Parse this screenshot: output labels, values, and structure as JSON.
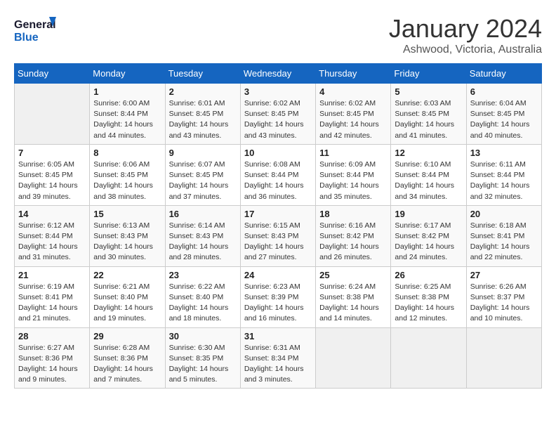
{
  "logo": {
    "line1": "General",
    "line2": "Blue"
  },
  "title": "January 2024",
  "subtitle": "Ashwood, Victoria, Australia",
  "weekdays": [
    "Sunday",
    "Monday",
    "Tuesday",
    "Wednesday",
    "Thursday",
    "Friday",
    "Saturday"
  ],
  "weeks": [
    [
      {
        "num": "",
        "info": ""
      },
      {
        "num": "1",
        "info": "Sunrise: 6:00 AM\nSunset: 8:44 PM\nDaylight: 14 hours\nand 44 minutes."
      },
      {
        "num": "2",
        "info": "Sunrise: 6:01 AM\nSunset: 8:45 PM\nDaylight: 14 hours\nand 43 minutes."
      },
      {
        "num": "3",
        "info": "Sunrise: 6:02 AM\nSunset: 8:45 PM\nDaylight: 14 hours\nand 43 minutes."
      },
      {
        "num": "4",
        "info": "Sunrise: 6:02 AM\nSunset: 8:45 PM\nDaylight: 14 hours\nand 42 minutes."
      },
      {
        "num": "5",
        "info": "Sunrise: 6:03 AM\nSunset: 8:45 PM\nDaylight: 14 hours\nand 41 minutes."
      },
      {
        "num": "6",
        "info": "Sunrise: 6:04 AM\nSunset: 8:45 PM\nDaylight: 14 hours\nand 40 minutes."
      }
    ],
    [
      {
        "num": "7",
        "info": "Sunrise: 6:05 AM\nSunset: 8:45 PM\nDaylight: 14 hours\nand 39 minutes."
      },
      {
        "num": "8",
        "info": "Sunrise: 6:06 AM\nSunset: 8:45 PM\nDaylight: 14 hours\nand 38 minutes."
      },
      {
        "num": "9",
        "info": "Sunrise: 6:07 AM\nSunset: 8:45 PM\nDaylight: 14 hours\nand 37 minutes."
      },
      {
        "num": "10",
        "info": "Sunrise: 6:08 AM\nSunset: 8:44 PM\nDaylight: 14 hours\nand 36 minutes."
      },
      {
        "num": "11",
        "info": "Sunrise: 6:09 AM\nSunset: 8:44 PM\nDaylight: 14 hours\nand 35 minutes."
      },
      {
        "num": "12",
        "info": "Sunrise: 6:10 AM\nSunset: 8:44 PM\nDaylight: 14 hours\nand 34 minutes."
      },
      {
        "num": "13",
        "info": "Sunrise: 6:11 AM\nSunset: 8:44 PM\nDaylight: 14 hours\nand 32 minutes."
      }
    ],
    [
      {
        "num": "14",
        "info": "Sunrise: 6:12 AM\nSunset: 8:44 PM\nDaylight: 14 hours\nand 31 minutes."
      },
      {
        "num": "15",
        "info": "Sunrise: 6:13 AM\nSunset: 8:43 PM\nDaylight: 14 hours\nand 30 minutes."
      },
      {
        "num": "16",
        "info": "Sunrise: 6:14 AM\nSunset: 8:43 PM\nDaylight: 14 hours\nand 28 minutes."
      },
      {
        "num": "17",
        "info": "Sunrise: 6:15 AM\nSunset: 8:43 PM\nDaylight: 14 hours\nand 27 minutes."
      },
      {
        "num": "18",
        "info": "Sunrise: 6:16 AM\nSunset: 8:42 PM\nDaylight: 14 hours\nand 26 minutes."
      },
      {
        "num": "19",
        "info": "Sunrise: 6:17 AM\nSunset: 8:42 PM\nDaylight: 14 hours\nand 24 minutes."
      },
      {
        "num": "20",
        "info": "Sunrise: 6:18 AM\nSunset: 8:41 PM\nDaylight: 14 hours\nand 22 minutes."
      }
    ],
    [
      {
        "num": "21",
        "info": "Sunrise: 6:19 AM\nSunset: 8:41 PM\nDaylight: 14 hours\nand 21 minutes."
      },
      {
        "num": "22",
        "info": "Sunrise: 6:21 AM\nSunset: 8:40 PM\nDaylight: 14 hours\nand 19 minutes."
      },
      {
        "num": "23",
        "info": "Sunrise: 6:22 AM\nSunset: 8:40 PM\nDaylight: 14 hours\nand 18 minutes."
      },
      {
        "num": "24",
        "info": "Sunrise: 6:23 AM\nSunset: 8:39 PM\nDaylight: 14 hours\nand 16 minutes."
      },
      {
        "num": "25",
        "info": "Sunrise: 6:24 AM\nSunset: 8:38 PM\nDaylight: 14 hours\nand 14 minutes."
      },
      {
        "num": "26",
        "info": "Sunrise: 6:25 AM\nSunset: 8:38 PM\nDaylight: 14 hours\nand 12 minutes."
      },
      {
        "num": "27",
        "info": "Sunrise: 6:26 AM\nSunset: 8:37 PM\nDaylight: 14 hours\nand 10 minutes."
      }
    ],
    [
      {
        "num": "28",
        "info": "Sunrise: 6:27 AM\nSunset: 8:36 PM\nDaylight: 14 hours\nand 9 minutes."
      },
      {
        "num": "29",
        "info": "Sunrise: 6:28 AM\nSunset: 8:36 PM\nDaylight: 14 hours\nand 7 minutes."
      },
      {
        "num": "30",
        "info": "Sunrise: 6:30 AM\nSunset: 8:35 PM\nDaylight: 14 hours\nand 5 minutes."
      },
      {
        "num": "31",
        "info": "Sunrise: 6:31 AM\nSunset: 8:34 PM\nDaylight: 14 hours\nand 3 minutes."
      },
      {
        "num": "",
        "info": ""
      },
      {
        "num": "",
        "info": ""
      },
      {
        "num": "",
        "info": ""
      }
    ]
  ]
}
